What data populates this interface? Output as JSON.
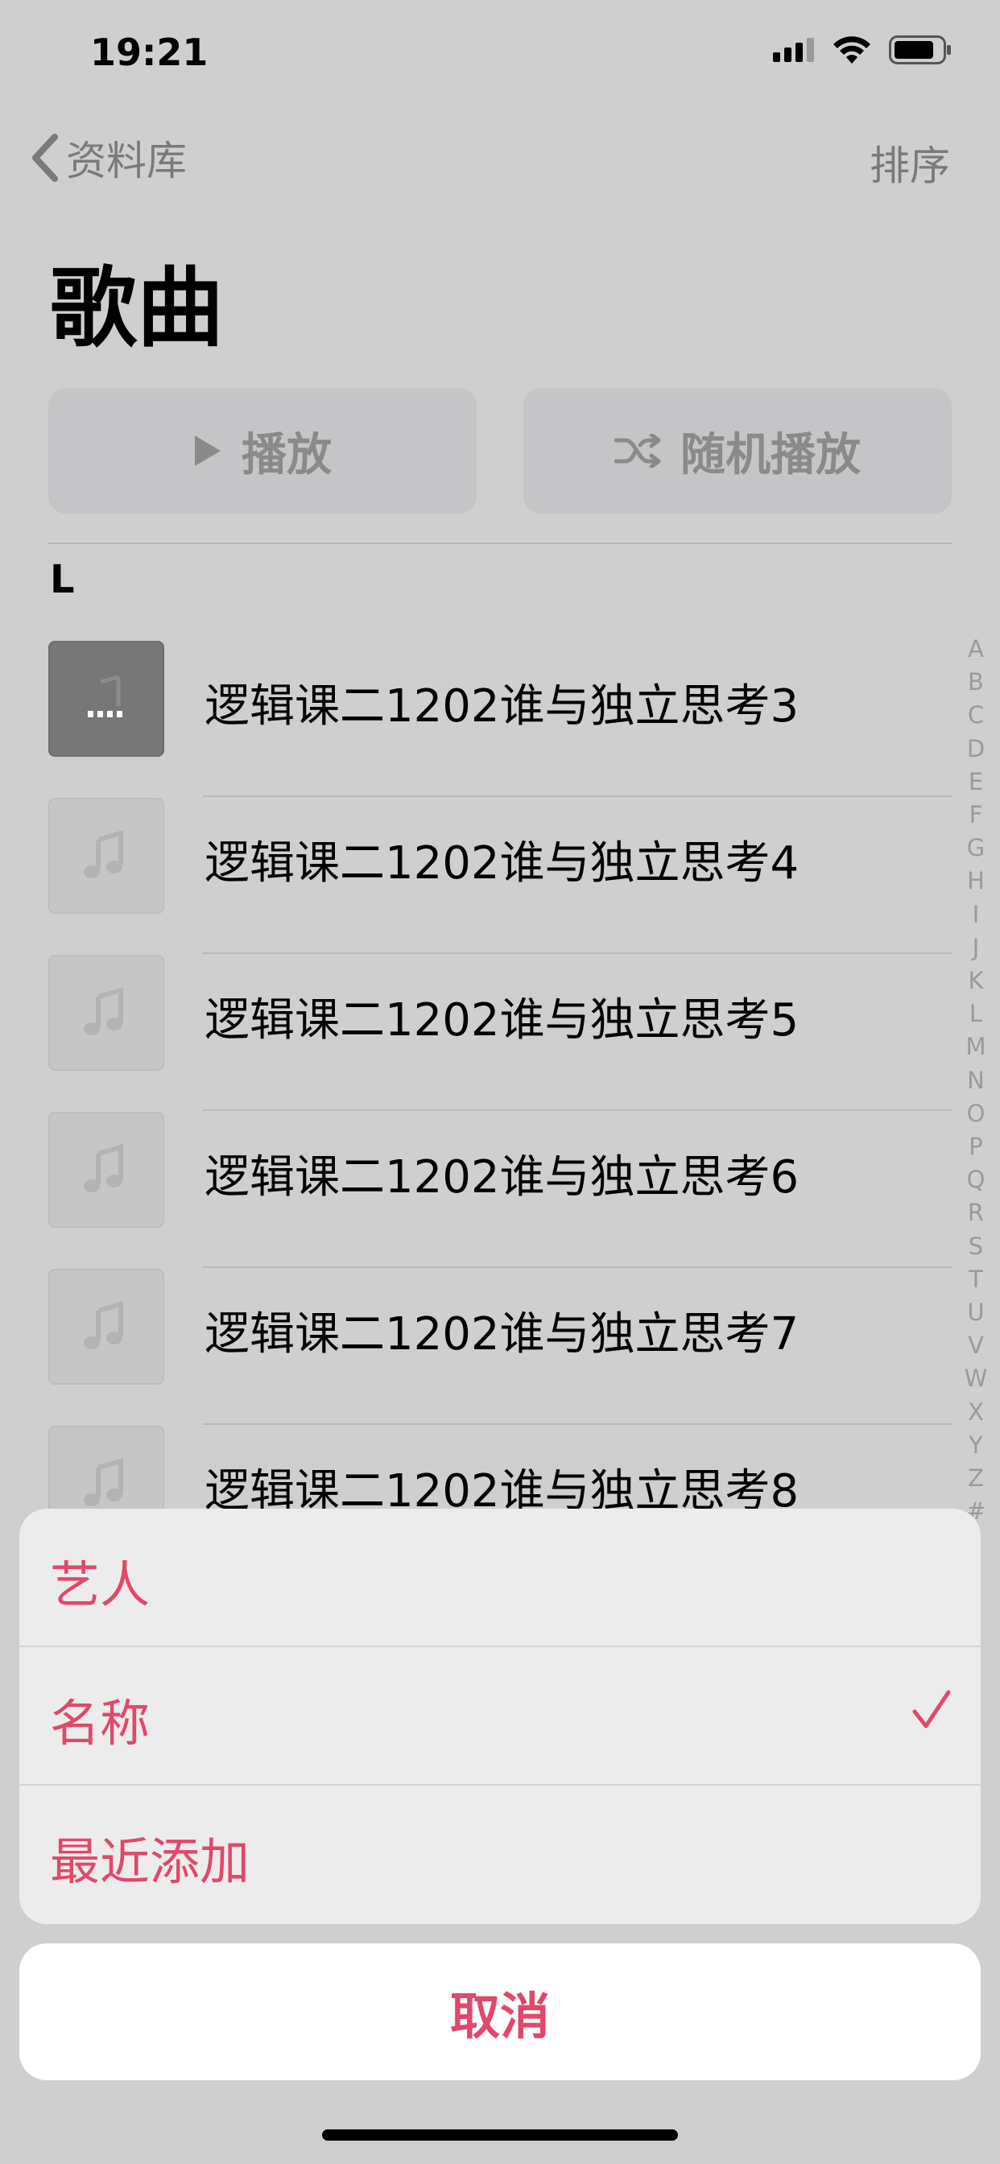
{
  "status_bar": {
    "time": "19:21"
  },
  "nav": {
    "back_label": "资料库",
    "sort_label": "排序"
  },
  "page": {
    "title": "歌曲"
  },
  "buttons": {
    "play_label": "播放",
    "shuffle_label": "随机播放"
  },
  "list": {
    "section_header": "L",
    "songs": [
      {
        "title": "逻辑课二1202谁与独立思考3"
      },
      {
        "title": "逻辑课二1202谁与独立思考4"
      },
      {
        "title": "逻辑课二1202谁与独立思考5"
      },
      {
        "title": "逻辑课二1202谁与独立思考6"
      },
      {
        "title": "逻辑课二1202谁与独立思考7"
      },
      {
        "title": "逻辑课二1202谁与独立思考8"
      }
    ]
  },
  "index_letters": [
    "A",
    "B",
    "C",
    "D",
    "E",
    "F",
    "G",
    "H",
    "I",
    "J",
    "K",
    "L",
    "M",
    "N",
    "O",
    "P",
    "Q",
    "R",
    "S",
    "T",
    "U",
    "V",
    "W",
    "X",
    "Y",
    "Z",
    "#"
  ],
  "sort_sheet": {
    "options": [
      {
        "label": "艺人",
        "selected": false
      },
      {
        "label": "名称",
        "selected": true
      },
      {
        "label": "最近添加",
        "selected": false
      }
    ],
    "cancel_label": "取消"
  },
  "colors": {
    "accent": "#e24869",
    "dim_text": "#7a7a7a",
    "overlay_bg": "#cfcfcf"
  }
}
